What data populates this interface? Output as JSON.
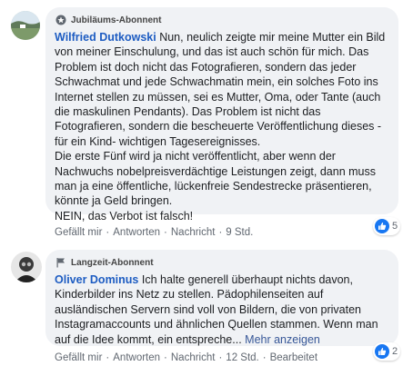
{
  "comments": [
    {
      "badge": "Jubiläums-Abonnent",
      "author": "Wilfried Dutkowski",
      "text": " Nun, neulich zeigte mir meine Mutter ein Bild von meiner Einschulung, und das ist auch schön für mich. Das Problem ist doch nicht das Fotografieren, sondern das jeder Schwachmat und jede Schwachmatin mein, ein solches Foto ins Internet stellen zu müssen, sei es Mutter, Oma, oder Tante (auch die maskulinen Pendants). Das Problem ist nicht das Fotografieren, sondern die bescheuerte Veröffentlichung dieses -für ein Kind- wichtigen Tagesereignisses.\nDie erste Fünf wird ja nicht veröffentlicht, aber wenn der Nachwuchs nobelpreisverdächtige Leistungen zeigt, dann muss man ja eine öffentliche, lückenfreie Sendestrecke präsentieren, könnte ja Geld bringen.\nNEIN, das Verbot ist falsch!",
      "like": "Gefällt mir",
      "reply": "Antworten",
      "message": "Nachricht",
      "time": "9 Std.",
      "reaction_count": "5"
    },
    {
      "badge": "Langzeit-Abonnent",
      "author": "Oliver Dominus",
      "text": " Ich halte generell überhaupt nichts davon, Kinderbilder ins Netz zu stellen. Pädophilenseiten auf ausländischen Servern sind voll von Bildern, die von privaten Instagramaccounts und ähnlichen Quellen stammen. Wenn man auf die Idee kommt, ein entspreche... ",
      "more": "Mehr anzeigen",
      "like": "Gefällt mir",
      "reply": "Antworten",
      "message": "Nachricht",
      "time": "12 Std.",
      "edited": "Bearbeitet",
      "reaction_count": "2"
    }
  ]
}
